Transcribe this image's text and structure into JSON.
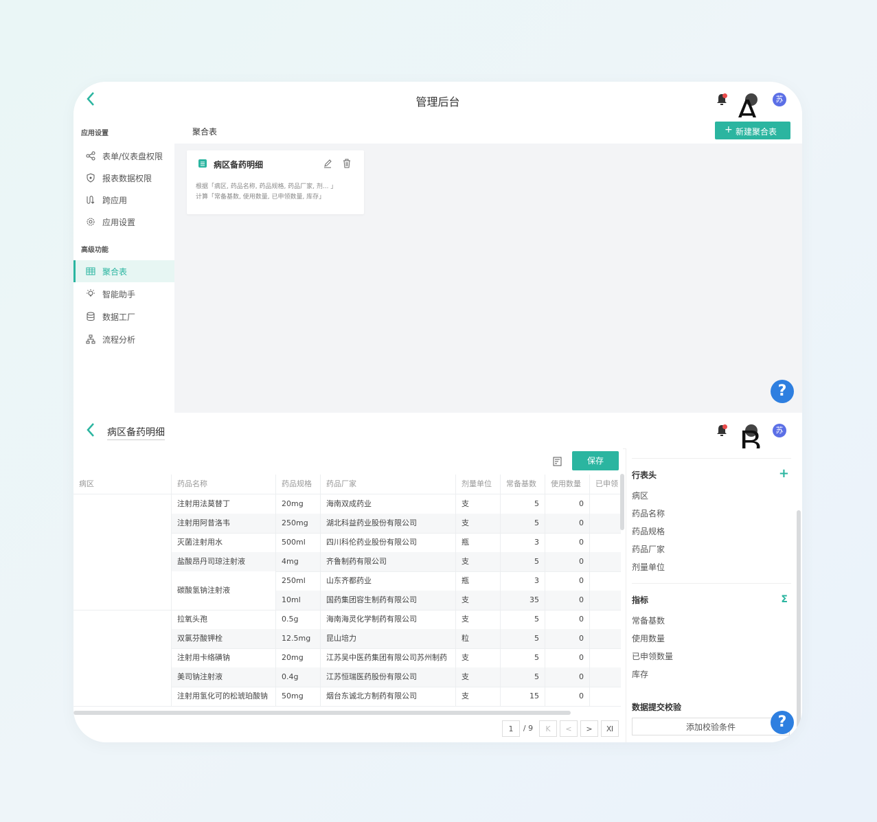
{
  "labels": {
    "a": "A",
    "b": "B"
  },
  "app": {
    "title": "管理后台",
    "avatar_text": "苏"
  },
  "sidebar": {
    "sections": [
      "应用设置",
      "高级功能"
    ],
    "items": [
      {
        "label": "表单/仪表盘权限",
        "icon": "share-icon"
      },
      {
        "label": "报表数据权限",
        "icon": "shield-icon"
      },
      {
        "label": "跨应用",
        "icon": "cross-app-icon"
      },
      {
        "label": "应用设置",
        "icon": "gear-icon"
      },
      {
        "label": "聚合表",
        "icon": "table-icon"
      },
      {
        "label": "智能助手",
        "icon": "bulb-icon"
      },
      {
        "label": "数据工厂",
        "icon": "database-icon"
      },
      {
        "label": "流程分析",
        "icon": "flow-icon"
      }
    ]
  },
  "mainA": {
    "header": "聚合表",
    "new_button": "新建聚合表",
    "card": {
      "title": "病区备药明细",
      "desc_line1": "根据「病区, 药品名称, 药品规格, 药品厂家, 剂... 」",
      "desc_line2": "计算「常备基数, 使用数量, 已申领数量, 库存」"
    }
  },
  "mainB": {
    "title": "病区备药明细",
    "save_button": "保存",
    "columns": [
      "病区",
      "药品名称",
      "药品规格",
      "药品厂家",
      "剂量单位",
      "常备基数",
      "使用数量",
      "已申领"
    ],
    "rows": [
      {
        "name": "注射用法莫替丁",
        "spec": "20mg",
        "maker": "海南双成药业",
        "unit": "支",
        "base": "5",
        "used": "0"
      },
      {
        "name": "注射用阿昔洛韦",
        "spec": "250mg",
        "maker": "湖北科益药业股份有限公司",
        "unit": "支",
        "base": "5",
        "used": "0"
      },
      {
        "name": "灭菌注射用水",
        "spec": "500ml",
        "maker": "四川科伦药业股份有限公司",
        "unit": "瓶",
        "base": "3",
        "used": "0"
      },
      {
        "name": "盐酸昂丹司琼注射液",
        "spec": "4mg",
        "maker": "齐鲁制药有限公司",
        "unit": "支",
        "base": "5",
        "used": "0"
      },
      {
        "name": "碳酸氢钠注射液",
        "spec": "250ml",
        "maker": "山东齐都药业",
        "unit": "瓶",
        "base": "3",
        "used": "0"
      },
      {
        "name": "",
        "spec": "10ml",
        "maker": "国药集团容生制药有限公司",
        "unit": "支",
        "base": "35",
        "used": "0"
      },
      {
        "name": "拉氧头孢",
        "spec": "0.5g",
        "maker": "海南海灵化学制药有限公司",
        "unit": "支",
        "base": "5",
        "used": "0"
      },
      {
        "name": "双氯芬酸钾栓",
        "spec": "12.5mg",
        "maker": "昆山培力",
        "unit": "粒",
        "base": "5",
        "used": "0"
      },
      {
        "name": "注射用卡络磺钠",
        "spec": "20mg",
        "maker": "江苏吴中医药集团有限公司苏州制药",
        "unit": "支",
        "base": "5",
        "used": "0"
      },
      {
        "name": "美司钠注射液",
        "spec": "0.4g",
        "maker": "江苏恒瑞医药股份有限公司",
        "unit": "支",
        "base": "5",
        "used": "0"
      },
      {
        "name": "注射用氢化可的松琥珀酸钠",
        "spec": "50mg",
        "maker": "烟台东诚北方制药有限公司",
        "unit": "支",
        "base": "15",
        "used": "0"
      }
    ],
    "pager": {
      "current": "1",
      "total": "/ 9",
      "first": "K",
      "prev": "<",
      "next": ">",
      "last": "Ⅺ"
    },
    "panel": {
      "row_header_title": "行表头",
      "row_headers": [
        "病区",
        "药品名称",
        "药品规格",
        "药品厂家",
        "剂量单位"
      ],
      "metrics_title": "指标",
      "metrics": [
        "常备基数",
        "使用数量",
        "已申领数量",
        "库存"
      ],
      "check_title": "数据提交校验",
      "add_check": "添加校验条件",
      "plus": "+",
      "sigma": "Σ"
    }
  },
  "help": "?"
}
